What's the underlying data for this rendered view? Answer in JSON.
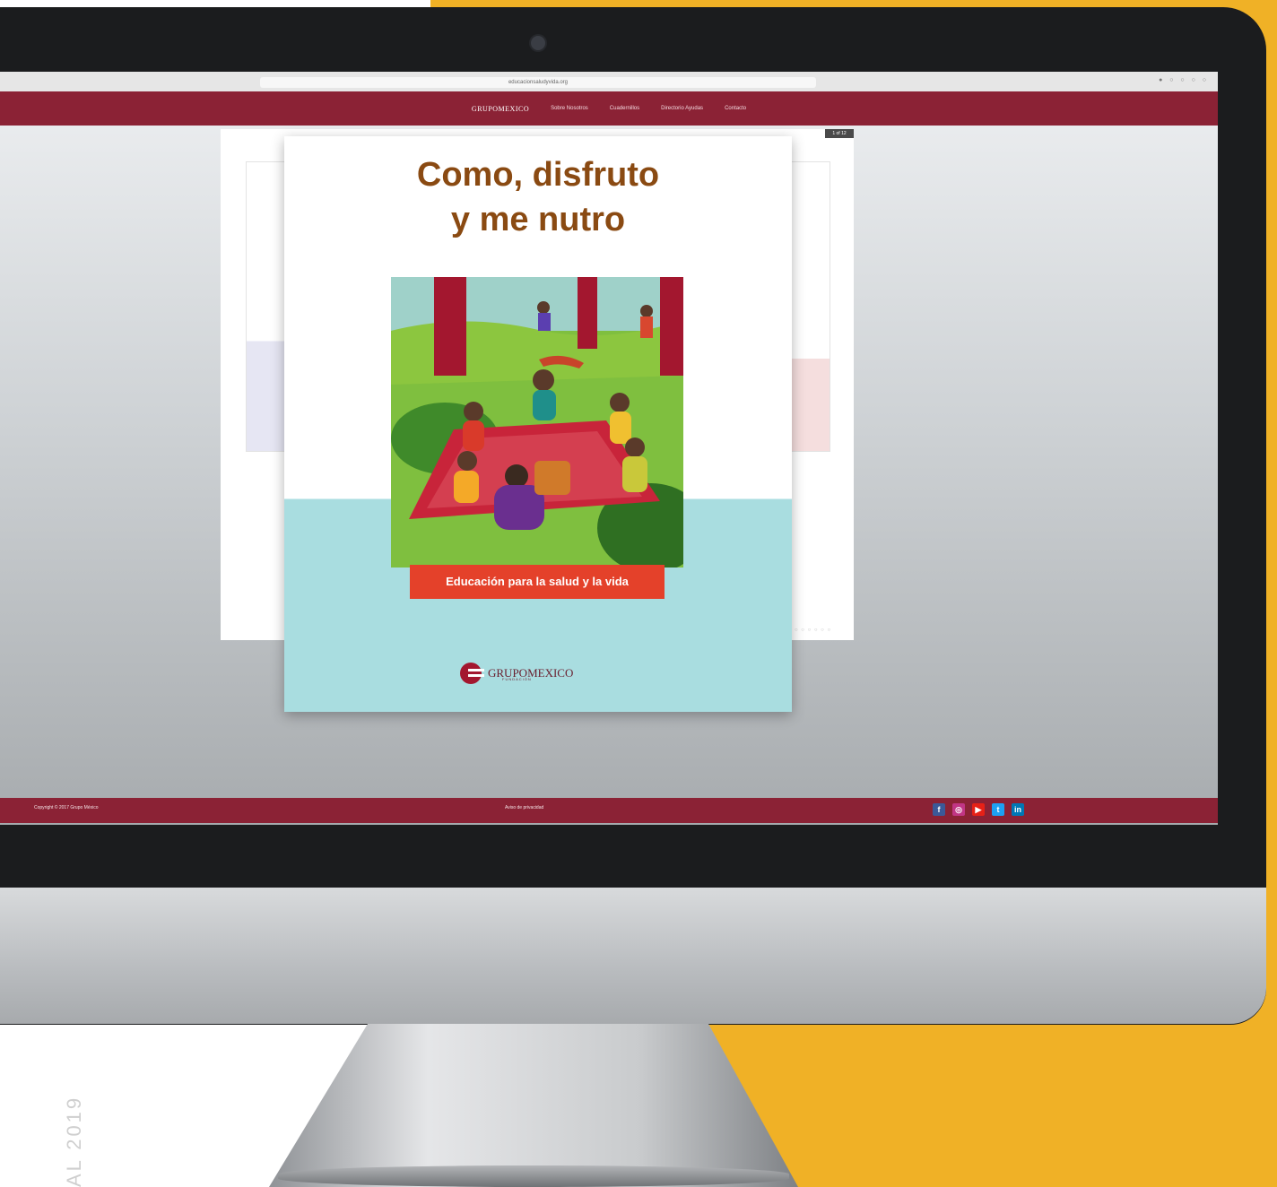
{
  "background": {
    "accent_color": "#f0b126"
  },
  "browser": {
    "url": "educacionsaludyvida.org"
  },
  "site": {
    "brand": "GRUPOMEXICO",
    "brand_sub": "FUNDACIÓN",
    "nav": [
      "Sobre Nosotros",
      "Cuadernillos",
      "Directorio Ayudas",
      "Contacto"
    ],
    "accent_color": "#8b2235"
  },
  "viewer": {
    "page_counter": "1 of 12",
    "pager_dots": "○ ○ ○ ○ ○ ○"
  },
  "cover": {
    "title": "Como, disfruto\ny me nutro",
    "tagline": "Educación para la salud y la vida",
    "logo_text": "GRUPOMEXICO",
    "logo_sub": "FUNDACIÓN"
  },
  "footer": {
    "copyright": "Copyright © 2017 Grupo México",
    "privacy": "Aviso de privacidad",
    "social": [
      "facebook-icon",
      "instagram-icon",
      "youtube-icon",
      "twitter-icon",
      "linkedin-icon"
    ]
  },
  "side_label": "AL 2019"
}
